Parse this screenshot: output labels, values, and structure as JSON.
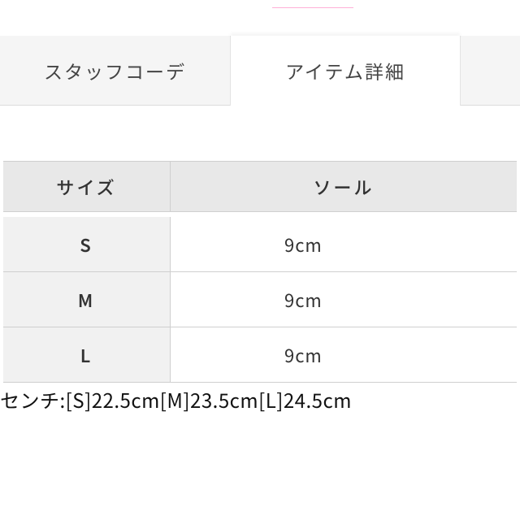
{
  "tabs": {
    "staff_coord": "スタッフコーデ",
    "item_detail": "アイテム詳細"
  },
  "table": {
    "headers": {
      "size": "サイズ",
      "sole": "ソール"
    },
    "rows": [
      {
        "size": "S",
        "sole": "9cm"
      },
      {
        "size": "M",
        "sole": "9cm"
      },
      {
        "size": "L",
        "sole": "9cm"
      }
    ]
  },
  "footer_cm_line": "センチ:[S]22.5cm[M]23.5cm[L]24.5cm"
}
